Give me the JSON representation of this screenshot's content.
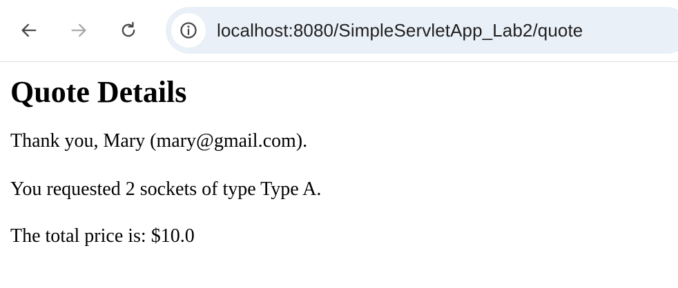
{
  "browser": {
    "url": "localhost:8080/SimpleServletApp_Lab2/quote",
    "icons": {
      "back": "arrow-left-icon",
      "forward": "arrow-right-icon",
      "reload": "reload-icon",
      "site_info": "info-icon"
    },
    "colors": {
      "omnibox_bg": "#eaf0f8",
      "icon_active": "#474747",
      "icon_disabled": "#a8a8a8"
    }
  },
  "page": {
    "heading": "Quote Details",
    "thank_you": "Thank you, Mary (mary@gmail.com).",
    "request": "You requested 2 sockets of type Type A.",
    "total": "The total price is: $10.0"
  }
}
